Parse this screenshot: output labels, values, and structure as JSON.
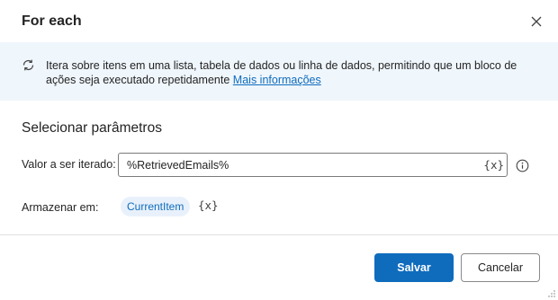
{
  "dialog": {
    "title": "For each",
    "close_icon": "close-icon"
  },
  "info": {
    "icon": "loop-icon",
    "text": "Itera sobre itens em uma lista, tabela de dados ou linha de dados, permitindo que um bloco de ações seja executado repetidamente",
    "link_label": "Mais informações"
  },
  "parameters": {
    "section_title": "Selecionar parâmetros",
    "iterate": {
      "label": "Valor a ser iterado:",
      "value": "%RetrievedEmails%",
      "var_button": "{x}",
      "help_icon": "info-circle-icon"
    },
    "store": {
      "label": "Armazenar em:",
      "variable": "CurrentItem",
      "var_button": "{x}"
    }
  },
  "footer": {
    "save_label": "Salvar",
    "cancel_label": "Cancelar"
  },
  "colors": {
    "accent": "#0f6cbd",
    "info_bg": "#eff6fc",
    "chip_bg": "#e8f1fb"
  }
}
